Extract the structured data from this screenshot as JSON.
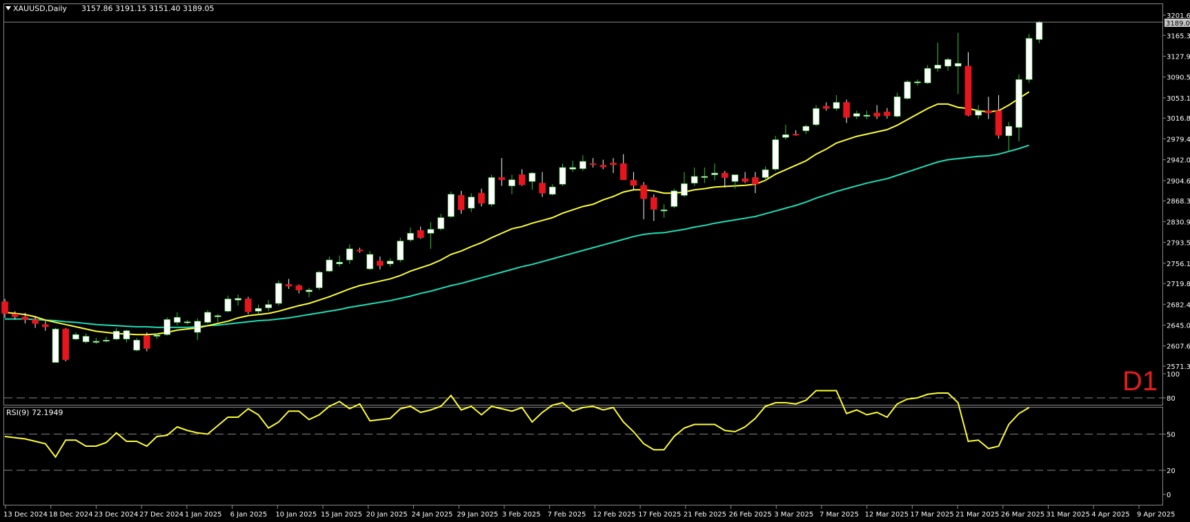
{
  "header": {
    "symbol_label": "XAUUSD,Daily",
    "ohlc": "3157.86 3191.15 3151.40 3189.05",
    "timeframe_badge": "D1"
  },
  "colors": {
    "background": "#000000",
    "bull_candle": "#ffffff",
    "bear_candle": "#e8161c",
    "ma_fast": "#ffff33",
    "ma_slow": "#1de0b8",
    "rsi_line": "#ffff33",
    "grid": "#8a8a8a"
  },
  "chart_data": [
    {
      "type": "candlestick",
      "title": "XAUUSD,Daily",
      "ylim": [
        2571.3,
        3201.6
      ],
      "y_ticks": [
        "3201.60",
        "3165.30",
        "3127.90",
        "3090.50",
        "3053.10",
        "3016.80",
        "2979.40",
        "2942.00",
        "2904.60",
        "2868.30",
        "2830.90",
        "2793.50",
        "2756.10",
        "2719.80",
        "2682.40",
        "2645.00",
        "2607.60",
        "2571.30"
      ],
      "current_price_label": "3189.05",
      "current_price": 3189.05,
      "x_ticks": [
        "13 Dec 2024",
        "18 Dec 2024",
        "23 Dec 2024",
        "27 Dec 2024",
        "1 Jan 2025",
        "6 Jan 2025",
        "10 Jan 2025",
        "15 Jan 2025",
        "20 Jan 2025",
        "24 Jan 2025",
        "29 Jan 2025",
        "3 Feb 2025",
        "7 Feb 2025",
        "12 Feb 2025",
        "17 Feb 2025",
        "21 Feb 2025",
        "26 Feb 2025",
        "3 Mar 2025",
        "7 Mar 2025",
        "12 Mar 2025",
        "17 Mar 2025",
        "21 Mar 2025",
        "26 Mar 2025",
        "31 Mar 2025",
        "4 Apr 2025",
        "9 Apr 2025"
      ],
      "ohlc": [
        [
          2687,
          2692,
          2658,
          2666
        ],
        [
          2665,
          2670,
          2655,
          2660
        ],
        [
          2660,
          2667,
          2648,
          2655
        ],
        [
          2655,
          2661,
          2640,
          2648
        ],
        [
          2646,
          2652,
          2635,
          2642
        ],
        [
          2578,
          2640,
          2578,
          2638
        ],
        [
          2638,
          2640,
          2580,
          2583
        ],
        [
          2620,
          2632,
          2618,
          2628
        ],
        [
          2615,
          2630,
          2612,
          2625
        ],
        [
          2614,
          2622,
          2611,
          2616
        ],
        [
          2618,
          2624,
          2614,
          2618
        ],
        [
          2620,
          2640,
          2618,
          2634
        ],
        [
          2620,
          2637,
          2614,
          2635
        ],
        [
          2600,
          2622,
          2598,
          2618
        ],
        [
          2626,
          2632,
          2598,
          2603
        ],
        [
          2625,
          2630,
          2620,
          2627
        ],
        [
          2628,
          2659,
          2626,
          2655
        ],
        [
          2650,
          2668,
          2645,
          2659
        ],
        [
          2650,
          2654,
          2646,
          2651
        ],
        [
          2632,
          2657,
          2618,
          2652
        ],
        [
          2650,
          2672,
          2648,
          2668
        ],
        [
          2660,
          2665,
          2650,
          2662
        ],
        [
          2670,
          2698,
          2668,
          2692
        ],
        [
          2690,
          2700,
          2680,
          2693
        ],
        [
          2692,
          2696,
          2665,
          2669
        ],
        [
          2670,
          2682,
          2664,
          2675
        ],
        [
          2676,
          2690,
          2670,
          2682
        ],
        [
          2684,
          2725,
          2680,
          2720
        ],
        [
          2718,
          2728,
          2710,
          2715
        ],
        [
          2716,
          2718,
          2702,
          2708
        ],
        [
          2705,
          2712,
          2695,
          2708
        ],
        [
          2712,
          2742,
          2708,
          2740
        ],
        [
          2742,
          2768,
          2740,
          2762
        ],
        [
          2755,
          2770,
          2750,
          2758
        ],
        [
          2762,
          2790,
          2755,
          2782
        ],
        [
          2780,
          2784,
          2775,
          2778
        ],
        [
          2746,
          2778,
          2744,
          2772
        ],
        [
          2760,
          2768,
          2745,
          2752
        ],
        [
          2755,
          2765,
          2750,
          2760
        ],
        [
          2762,
          2802,
          2758,
          2796
        ],
        [
          2798,
          2820,
          2795,
          2810
        ],
        [
          2815,
          2822,
          2800,
          2802
        ],
        [
          2810,
          2830,
          2782,
          2817
        ],
        [
          2818,
          2845,
          2815,
          2838
        ],
        [
          2840,
          2885,
          2838,
          2880
        ],
        [
          2878,
          2886,
          2845,
          2852
        ],
        [
          2855,
          2882,
          2848,
          2875
        ],
        [
          2882,
          2890,
          2858,
          2864
        ],
        [
          2862,
          2915,
          2858,
          2910
        ],
        [
          2910,
          2945,
          2895,
          2906
        ],
        [
          2895,
          2915,
          2880,
          2906
        ],
        [
          2915,
          2925,
          2895,
          2897
        ],
        [
          2903,
          2920,
          2888,
          2918
        ],
        [
          2900,
          2920,
          2875,
          2882
        ],
        [
          2880,
          2898,
          2878,
          2893
        ],
        [
          2898,
          2935,
          2895,
          2928
        ],
        [
          2925,
          2940,
          2920,
          2928
        ],
        [
          2926,
          2950,
          2922,
          2939
        ],
        [
          2935,
          2945,
          2928,
          2934
        ],
        [
          2932,
          2942,
          2925,
          2929
        ],
        [
          2936,
          2945,
          2918,
          2933
        ],
        [
          2935,
          2952,
          2912,
          2906
        ],
        [
          2905,
          2920,
          2888,
          2896
        ],
        [
          2896,
          2902,
          2835,
          2872
        ],
        [
          2874,
          2880,
          2832,
          2853
        ],
        [
          2850,
          2862,
          2838,
          2852
        ],
        [
          2858,
          2890,
          2855,
          2886
        ],
        [
          2878,
          2920,
          2875,
          2899
        ],
        [
          2900,
          2928,
          2895,
          2912
        ],
        [
          2910,
          2928,
          2900,
          2912
        ],
        [
          2915,
          2935,
          2905,
          2918
        ],
        [
          2918,
          2922,
          2892,
          2910
        ],
        [
          2903,
          2910,
          2890,
          2915
        ],
        [
          2908,
          2920,
          2900,
          2903
        ],
        [
          2910,
          2920,
          2882,
          2898
        ],
        [
          2910,
          2930,
          2905,
          2924
        ],
        [
          2925,
          2985,
          2922,
          2978
        ],
        [
          2982,
          3005,
          2978,
          2987
        ],
        [
          2988,
          2995,
          2985,
          2987
        ],
        [
          2994,
          3005,
          2988,
          3002
        ],
        [
          3005,
          3040,
          3002,
          3034
        ],
        [
          3038,
          3045,
          3030,
          3034
        ],
        [
          3034,
          3058,
          3030,
          3045
        ],
        [
          3045,
          3050,
          3008,
          3018
        ],
        [
          3020,
          3030,
          3015,
          3025
        ],
        [
          3020,
          3030,
          3015,
          3022
        ],
        [
          3026,
          3040,
          3015,
          3020
        ],
        [
          3028,
          3035,
          3016,
          3021
        ],
        [
          3020,
          3062,
          3018,
          3055
        ],
        [
          3052,
          3085,
          3050,
          3082
        ],
        [
          3080,
          3086,
          3075,
          3082
        ],
        [
          3080,
          3112,
          3078,
          3106
        ],
        [
          3106,
          3152,
          3100,
          3112
        ],
        [
          3110,
          3125,
          3102,
          3122
        ],
        [
          3110,
          3170,
          3060,
          3115
        ],
        [
          3110,
          3135,
          3020,
          3022
        ],
        [
          3022,
          3040,
          3015,
          3030
        ],
        [
          3030,
          3055,
          3015,
          3026
        ],
        [
          3030,
          3058,
          2980,
          2986
        ],
        [
          2985,
          3010,
          2958,
          3002
        ],
        [
          3000,
          3095,
          2975,
          3086
        ],
        [
          3086,
          3168,
          3080,
          3160
        ],
        [
          3157.86,
          3191.15,
          3151.4,
          3189.05
        ]
      ],
      "series": [
        {
          "name": "",
          "values": [
            2668,
            2666,
            2664,
            2660,
            2654,
            2650,
            2646,
            2642,
            2638,
            2634,
            2632,
            2630,
            2629,
            2628,
            2628,
            2629,
            2632,
            2636,
            2638,
            2640,
            2644,
            2648,
            2652,
            2658,
            2662,
            2664,
            2666,
            2670,
            2675,
            2680,
            2684,
            2690,
            2696,
            2703,
            2710,
            2716,
            2720,
            2724,
            2728,
            2734,
            2742,
            2748,
            2754,
            2762,
            2772,
            2778,
            2786,
            2793,
            2802,
            2810,
            2818,
            2822,
            2828,
            2833,
            2838,
            2846,
            2852,
            2858,
            2862,
            2870,
            2876,
            2884,
            2888,
            2888,
            2886,
            2882,
            2882,
            2884,
            2888,
            2890,
            2893,
            2894,
            2895,
            2896,
            2898,
            2905,
            2916,
            2924,
            2932,
            2940,
            2952,
            2961,
            2972,
            2978,
            2984,
            2988,
            2992,
            2996,
            3004,
            3014,
            3024,
            3034,
            3042,
            3042,
            3036,
            3034,
            3030,
            3028,
            3030,
            3040,
            3052,
            3064
          ]
        },
        {
          "name": "",
          "values": [
            2656,
            2656,
            2656,
            2655,
            2654,
            2653,
            2651,
            2650,
            2648,
            2646,
            2645,
            2644,
            2643,
            2642,
            2642,
            2641,
            2641,
            2641,
            2641,
            2642,
            2644,
            2645,
            2647,
            2649,
            2651,
            2653,
            2654,
            2656,
            2658,
            2661,
            2664,
            2667,
            2670,
            2673,
            2677,
            2680,
            2683,
            2686,
            2689,
            2693,
            2697,
            2702,
            2706,
            2711,
            2716,
            2720,
            2725,
            2730,
            2735,
            2740,
            2745,
            2750,
            2754,
            2759,
            2764,
            2769,
            2774,
            2779,
            2784,
            2789,
            2794,
            2799,
            2804,
            2808,
            2810,
            2811,
            2814,
            2817,
            2821,
            2824,
            2828,
            2831,
            2834,
            2837,
            2840,
            2845,
            2850,
            2855,
            2860,
            2866,
            2873,
            2879,
            2885,
            2890,
            2895,
            2900,
            2904,
            2908,
            2914,
            2920,
            2926,
            2932,
            2938,
            2942,
            2944,
            2946,
            2948,
            2949,
            2952,
            2957,
            2962,
            2968
          ]
        }
      ]
    },
    {
      "type": "line",
      "title": "RSI(9) 72.1949",
      "ylim": [
        0,
        100
      ],
      "y_ticks": [
        "100",
        "80",
        "50",
        "20",
        "0"
      ],
      "levels": [
        80,
        50,
        20
      ],
      "values": [
        48,
        47,
        46,
        44,
        42,
        31,
        45,
        45,
        40,
        40,
        43,
        51,
        44,
        44,
        40,
        48,
        49,
        56,
        53,
        51,
        50,
        57,
        64,
        64,
        71,
        66,
        55,
        60,
        69,
        69,
        62,
        66,
        73,
        77,
        71,
        75,
        61,
        62,
        63,
        71,
        73,
        68,
        70,
        73,
        82,
        70,
        73,
        66,
        73,
        71,
        69,
        72,
        60,
        68,
        74,
        76,
        69,
        72,
        73,
        70,
        72,
        60,
        52,
        42,
        37,
        37,
        48,
        55,
        58,
        58,
        58,
        53,
        52,
        56,
        63,
        73,
        76,
        76,
        75,
        78,
        86,
        86,
        86,
        67,
        70,
        66,
        68,
        64,
        75,
        79,
        80,
        83,
        84,
        84,
        76,
        44,
        45,
        38,
        40,
        58,
        67,
        72
      ]
    }
  ]
}
